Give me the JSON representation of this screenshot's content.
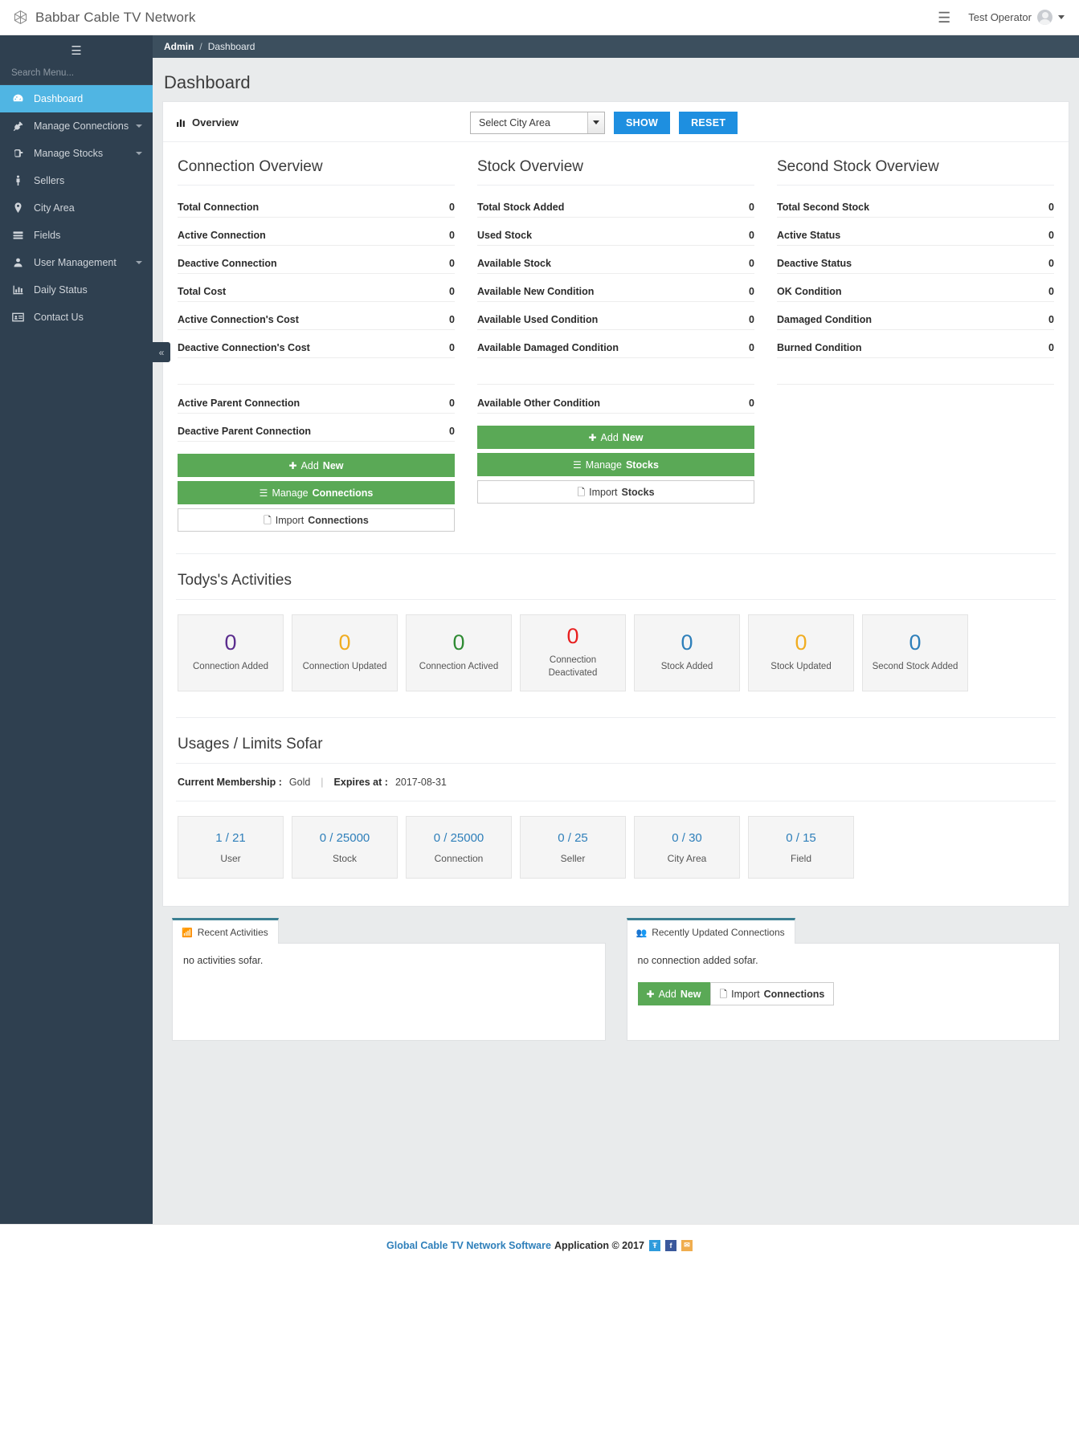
{
  "topbar": {
    "brand": "Babbar Cable TV Network",
    "brand_icon": "network-logo-icon",
    "menu_icon": "hamburger-icon",
    "user_name": "Test Operator",
    "avatar_icon": "avatar-icon",
    "caret_icon": "chevron-down-icon"
  },
  "sidebar": {
    "toggle_icon": "hamburger-icon",
    "search_placeholder": "Search Menu...",
    "collapse_icon": "«",
    "items": [
      {
        "label": "Dashboard",
        "icon": "dashboard-icon",
        "active": true,
        "has_arrow": false
      },
      {
        "label": "Manage Connections",
        "icon": "plug-icon",
        "active": false,
        "has_arrow": true
      },
      {
        "label": "Manage Stocks",
        "icon": "box-icon",
        "active": false,
        "has_arrow": true
      },
      {
        "label": "Sellers",
        "icon": "person-icon",
        "active": false,
        "has_arrow": false
      },
      {
        "label": "City Area",
        "icon": "map-pin-icon",
        "active": false,
        "has_arrow": false
      },
      {
        "label": "Fields",
        "icon": "list-icon",
        "active": false,
        "has_arrow": false
      },
      {
        "label": "User Management",
        "icon": "user-icon",
        "active": false,
        "has_arrow": true
      },
      {
        "label": "Daily Status",
        "icon": "bar-chart-icon",
        "active": false,
        "has_arrow": false
      },
      {
        "label": "Contact Us",
        "icon": "contact-card-icon",
        "active": false,
        "has_arrow": false
      }
    ]
  },
  "breadcrumb": {
    "root": "Admin",
    "sep": "/",
    "current": "Dashboard"
  },
  "page": {
    "title": "Dashboard"
  },
  "overview_head": {
    "title": "Overview",
    "title_icon": "bar-chart-icon",
    "select_value": "Select City Area",
    "show_label": "SHOW",
    "reset_label": "RESET"
  },
  "columns": [
    {
      "title": "Connection Overview",
      "rows": [
        {
          "label": "Total Connection",
          "value": "0"
        },
        {
          "label": "Active Connection",
          "value": "0"
        },
        {
          "label": "Deactive Connection",
          "value": "0"
        },
        {
          "label": "Total Cost",
          "value": "0"
        },
        {
          "label": "Active Connection's Cost",
          "value": "0"
        },
        {
          "label": "Deactive Connection's Cost",
          "value": "0"
        },
        {
          "label": "",
          "value": ""
        },
        {
          "label": "Active Parent Connection",
          "value": "0"
        },
        {
          "label": "Deactive Parent Connection",
          "value": "0"
        }
      ],
      "buttons": [
        {
          "icon": "plus-icon",
          "light": "Add ",
          "bold": "New",
          "style": "green"
        },
        {
          "icon": "list-icon",
          "light": "Manage ",
          "bold": "Connections",
          "style": "green"
        },
        {
          "icon": "file-icon",
          "light": "Import ",
          "bold": "Connections",
          "style": "white"
        }
      ]
    },
    {
      "title": "Stock Overview",
      "rows": [
        {
          "label": "Total Stock Added",
          "value": "0"
        },
        {
          "label": "Used Stock",
          "value": "0"
        },
        {
          "label": "Available Stock",
          "value": "0"
        },
        {
          "label": "Available New Condition",
          "value": "0"
        },
        {
          "label": "Available Used Condition",
          "value": "0"
        },
        {
          "label": "Available Damaged Condition",
          "value": "0"
        },
        {
          "label": "",
          "value": ""
        },
        {
          "label": "Available Other Condition",
          "value": "0"
        }
      ],
      "buttons": [
        {
          "icon": "plus-icon",
          "light": "Add ",
          "bold": "New",
          "style": "green"
        },
        {
          "icon": "list-icon",
          "light": "Manage ",
          "bold": "Stocks",
          "style": "green"
        },
        {
          "icon": "file-icon",
          "light": "Import ",
          "bold": "Stocks",
          "style": "white"
        }
      ]
    },
    {
      "title": "Second Stock Overview",
      "rows": [
        {
          "label": "Total Second Stock",
          "value": "0"
        },
        {
          "label": "Active Status",
          "value": "0"
        },
        {
          "label": "Deactive Status",
          "value": "0"
        },
        {
          "label": "OK Condition",
          "value": "0"
        },
        {
          "label": "Damaged Condition",
          "value": "0"
        },
        {
          "label": "Burned Condition",
          "value": "0"
        },
        {
          "label": "",
          "value": ""
        }
      ],
      "buttons": []
    }
  ],
  "activities": {
    "title": "Todys's Activities",
    "tiles": [
      {
        "value": "0",
        "label": "Connection Added",
        "color": "#5b2d8e"
      },
      {
        "value": "0",
        "label": "Connection Updated",
        "color": "#f0ad22"
      },
      {
        "value": "0",
        "label": "Connection Actived",
        "color": "#2f8b33"
      },
      {
        "value": "0",
        "label": "Connection Deactivated",
        "color": "#e81f1f"
      },
      {
        "value": "0",
        "label": "Stock Added",
        "color": "#2e7fba"
      },
      {
        "value": "0",
        "label": "Stock Updated",
        "color": "#f0ad22"
      },
      {
        "value": "0",
        "label": "Second Stock Added",
        "color": "#2e7fba"
      }
    ]
  },
  "usages": {
    "title": "Usages / Limits Sofar",
    "membership_label": "Current Membership :",
    "membership_value": "Gold",
    "expires_label": "Expires at :",
    "expires_value": "2017-08-31",
    "tiles": [
      {
        "value": "1 / 21",
        "label": "User"
      },
      {
        "value": "0 / 25000",
        "label": "Stock"
      },
      {
        "value": "0 / 25000",
        "label": "Connection"
      },
      {
        "value": "0 / 25",
        "label": "Seller"
      },
      {
        "value": "0 / 30",
        "label": "City Area"
      },
      {
        "value": "0 / 15",
        "label": "Field"
      }
    ]
  },
  "panels": [
    {
      "tab_label": "Recent Activities",
      "tab_icon": "rss-icon",
      "empty_text": "no activities sofar.",
      "buttons": []
    },
    {
      "tab_label": "Recently Updated Connections",
      "tab_icon": "users-icon",
      "empty_text": "no connection added sofar.",
      "buttons": [
        {
          "icon": "plus-icon",
          "light": "Add ",
          "bold": "New",
          "style": "green"
        },
        {
          "icon": "file-icon",
          "light": "Import ",
          "bold": "Connections",
          "style": "white"
        }
      ]
    }
  ],
  "footer": {
    "link": "Global Cable TV Network Software",
    "app_text": "Application © 2017",
    "social": [
      {
        "name": "twitter-icon",
        "glyph": "Ŧ",
        "cls": "tw"
      },
      {
        "name": "facebook-icon",
        "glyph": "f",
        "cls": "fb"
      },
      {
        "name": "mail-icon",
        "glyph": "✉",
        "cls": "ml"
      }
    ]
  },
  "colors": {
    "accent": "#50b5e3",
    "green": "#5aa956",
    "blue": "#1e8fe0",
    "sidebar": "#2f4050"
  }
}
